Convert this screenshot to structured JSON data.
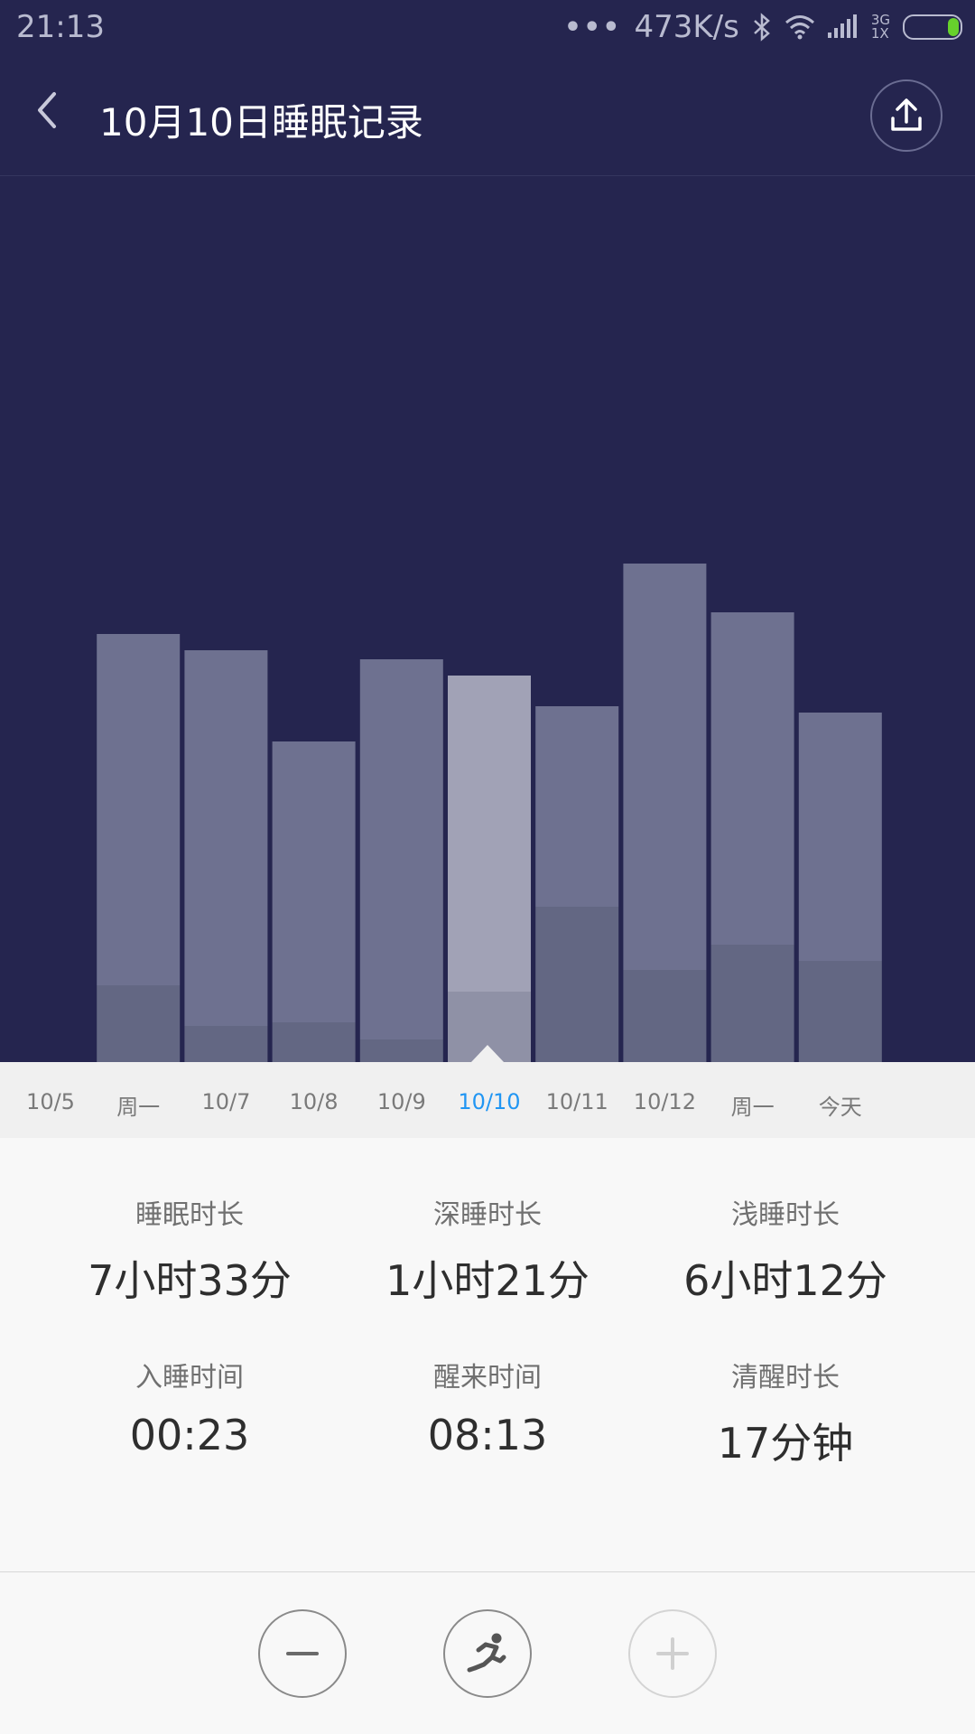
{
  "status_bar": {
    "time": "21:13",
    "dots": "•••",
    "speed": "473K/s",
    "network_top": "3G",
    "network_bottom": "1X"
  },
  "header": {
    "title": "10月10日睡眠记录",
    "icons": [
      "back-icon",
      "upload-icon"
    ]
  },
  "chart_data": {
    "type": "bar",
    "categories": [
      "10/5",
      "周一",
      "10/7",
      "10/8",
      "10/9",
      "10/10",
      "10/11",
      "10/12",
      "周一",
      "今天"
    ],
    "series": [
      {
        "name": "",
        "values": [
          0,
          474,
          456,
          355,
          446,
          428,
          394,
          552,
          498,
          387
        ]
      },
      {
        "name": "",
        "values": [
          0,
          85,
          40,
          44,
          25,
          78,
          172,
          102,
          130,
          112
        ]
      }
    ],
    "selected_index": 5,
    "colors": {
      "bar": "#6e7190",
      "bar_deep": "#636783",
      "bar_selected": "#a1a2b6",
      "bar_selected_deep": "#8f91a6"
    }
  },
  "stats": {
    "sleep_duration": {
      "label": "睡眠时长",
      "value": "7小时33分"
    },
    "deep_sleep": {
      "label": "深睡时长",
      "value": "1小时21分"
    },
    "light_sleep": {
      "label": "浅睡时长",
      "value": "6小时12分"
    },
    "sleep_time": {
      "label": "入睡时间",
      "value": "00:23"
    },
    "wake_time": {
      "label": "醒来时间",
      "value": "08:13"
    },
    "awake_duration": {
      "label": "清醒时长",
      "value": "17分钟"
    }
  },
  "actions": {
    "icons": [
      "minus-icon",
      "running-icon",
      "plus-icon"
    ]
  }
}
